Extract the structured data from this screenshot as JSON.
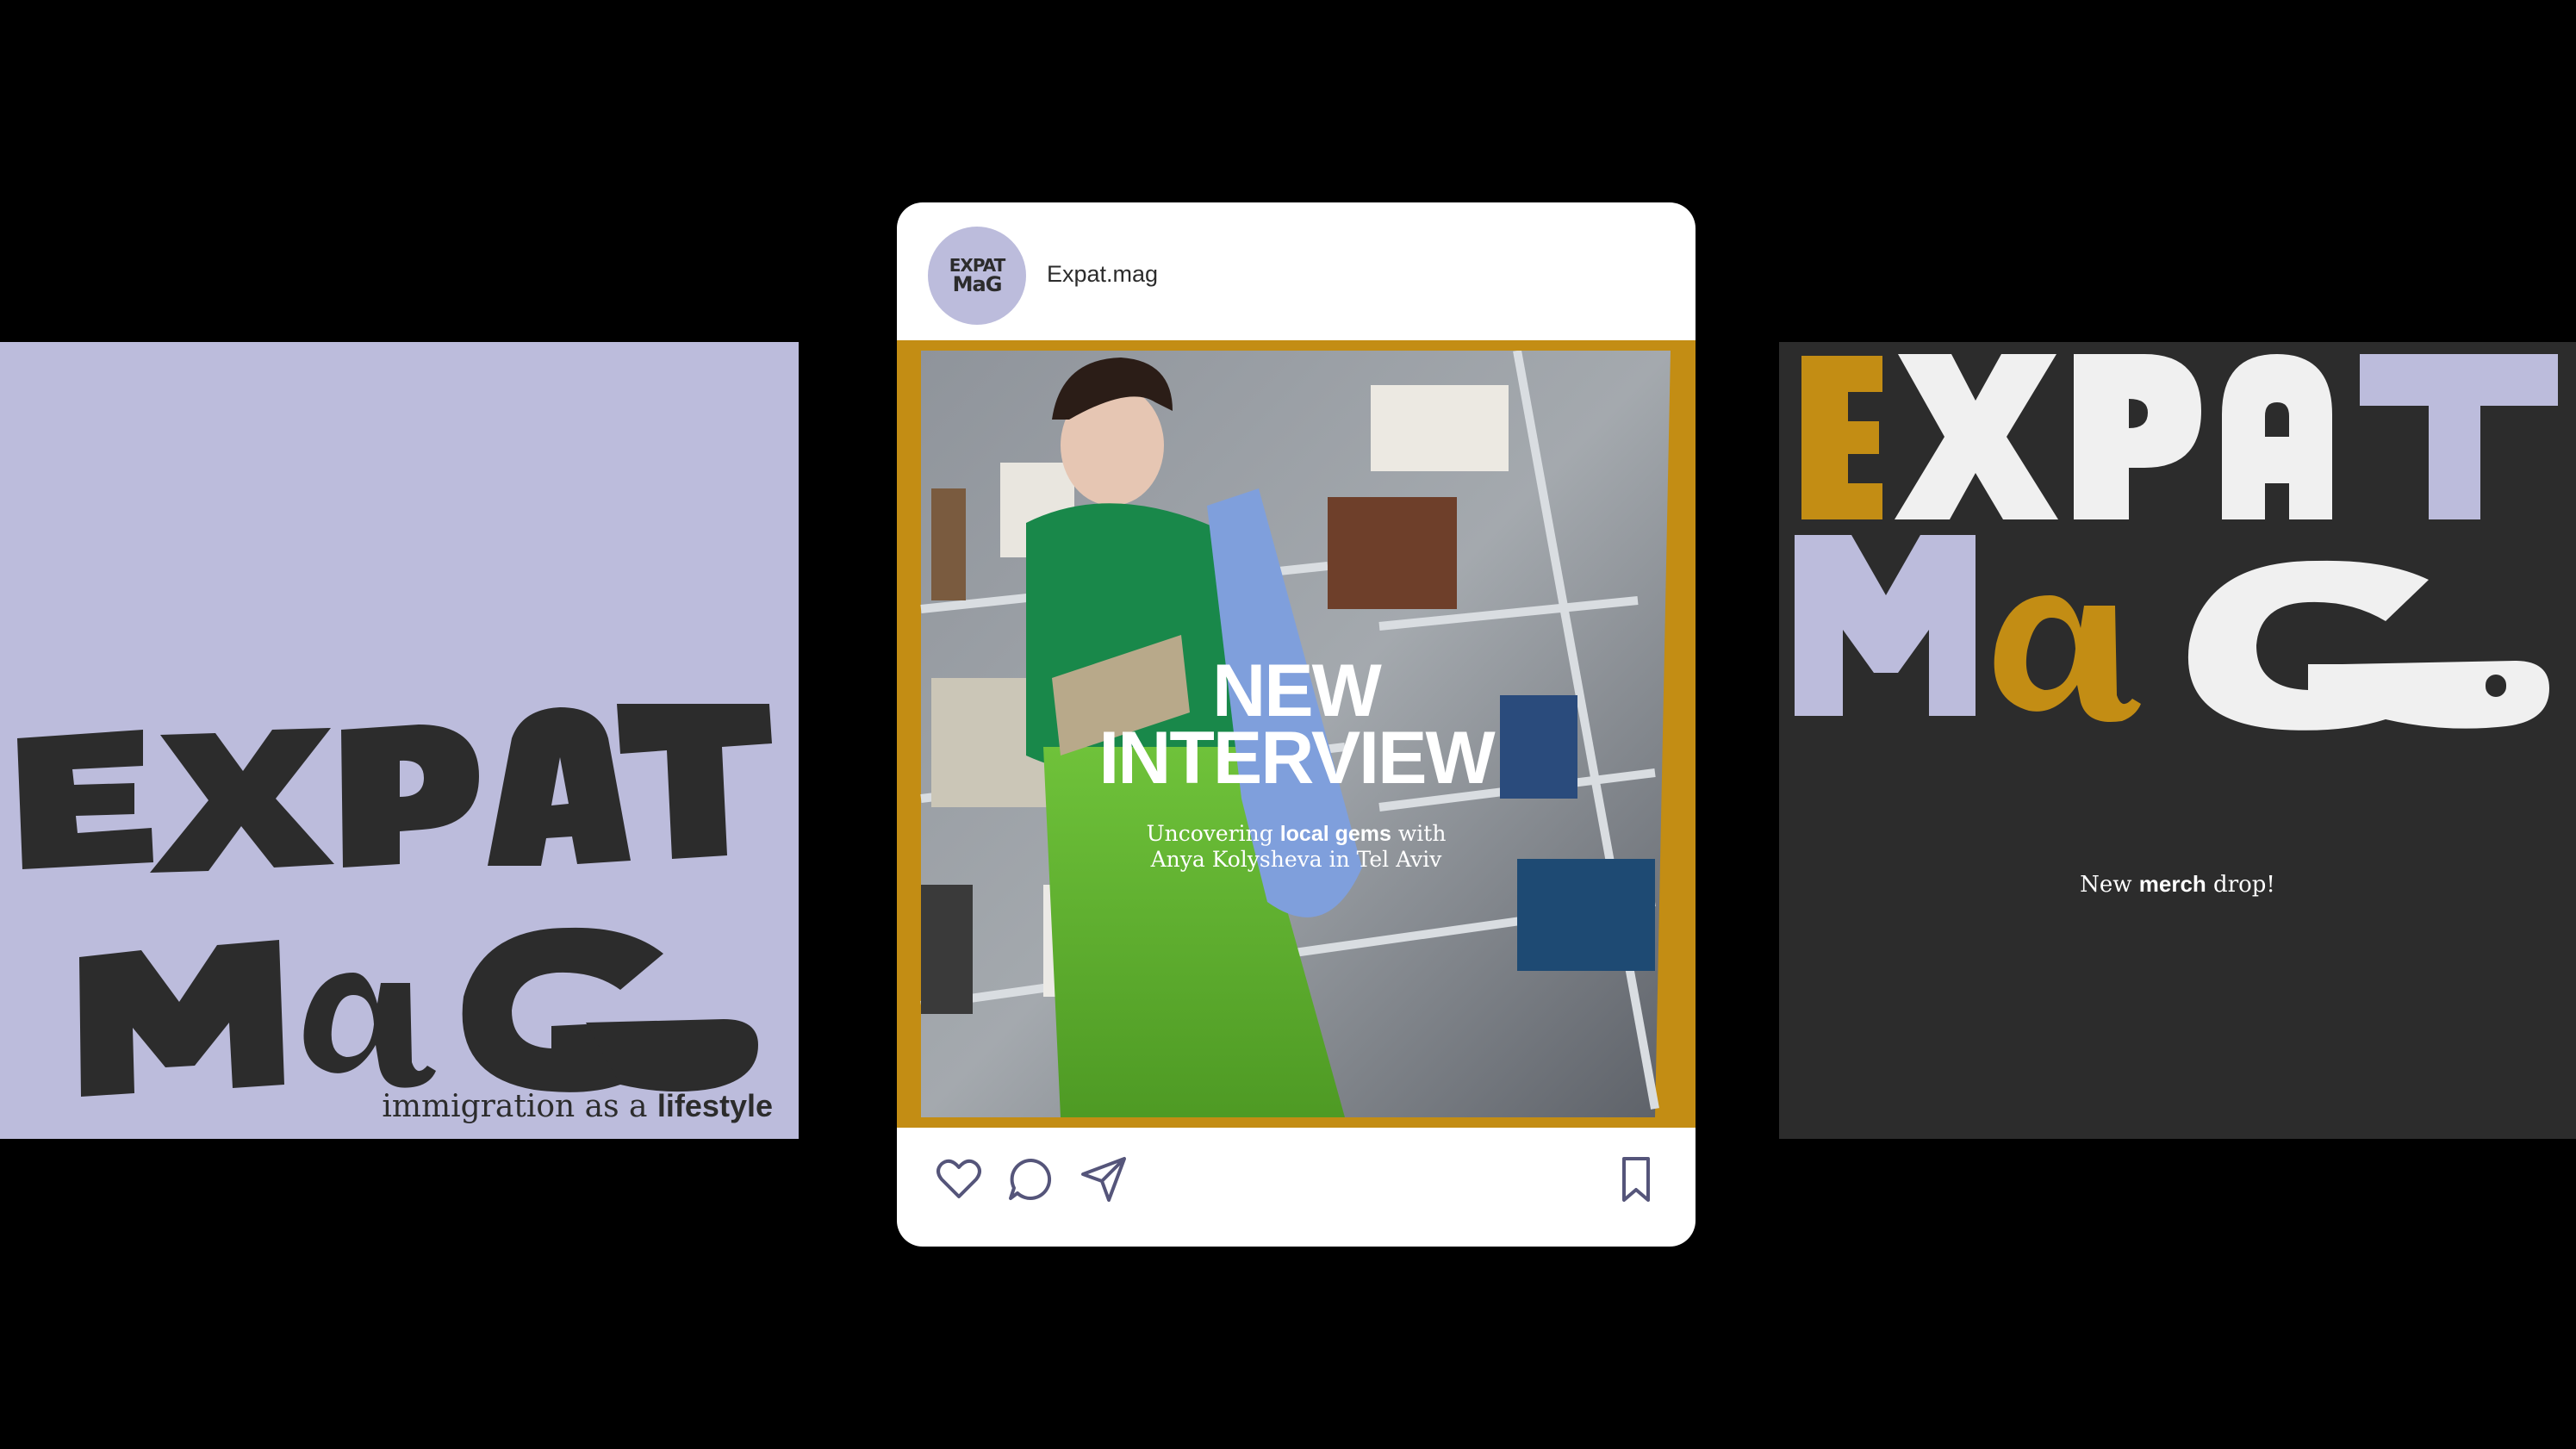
{
  "colors": {
    "background": "#000000",
    "lilac": "#bcbcdc",
    "charcoal": "#2c2c2c",
    "mustard": "#c38d14",
    "offwhite": "#f0f0f0",
    "card": "#ffffff",
    "icon_stroke": "#55557a"
  },
  "left_panel": {
    "logo_line1": "EXPAT",
    "logo_line2": "MaG",
    "tagline_regular": "immigration as a ",
    "tagline_bold": "lifestyle"
  },
  "post": {
    "avatar_logo_line1": "EXPAT",
    "avatar_logo_line2": "MaG",
    "account_name": "Expat.mag",
    "headline_line1": "NEW",
    "headline_line2": "INTERVIEW",
    "subtitle_1": "Uncovering ",
    "subtitle_bold": "local gems",
    "subtitle_2": " with",
    "subtitle_line2": "Anya Kolysheva in Tel Aviv",
    "actions": [
      "heart-icon",
      "comment-icon",
      "share-icon",
      "bookmark-icon"
    ]
  },
  "right_panel": {
    "logo_line1": "EXPAT",
    "logo_line2": "MaG",
    "merch_1": "New ",
    "merch_bold": "merch",
    "merch_2": " drop!"
  }
}
